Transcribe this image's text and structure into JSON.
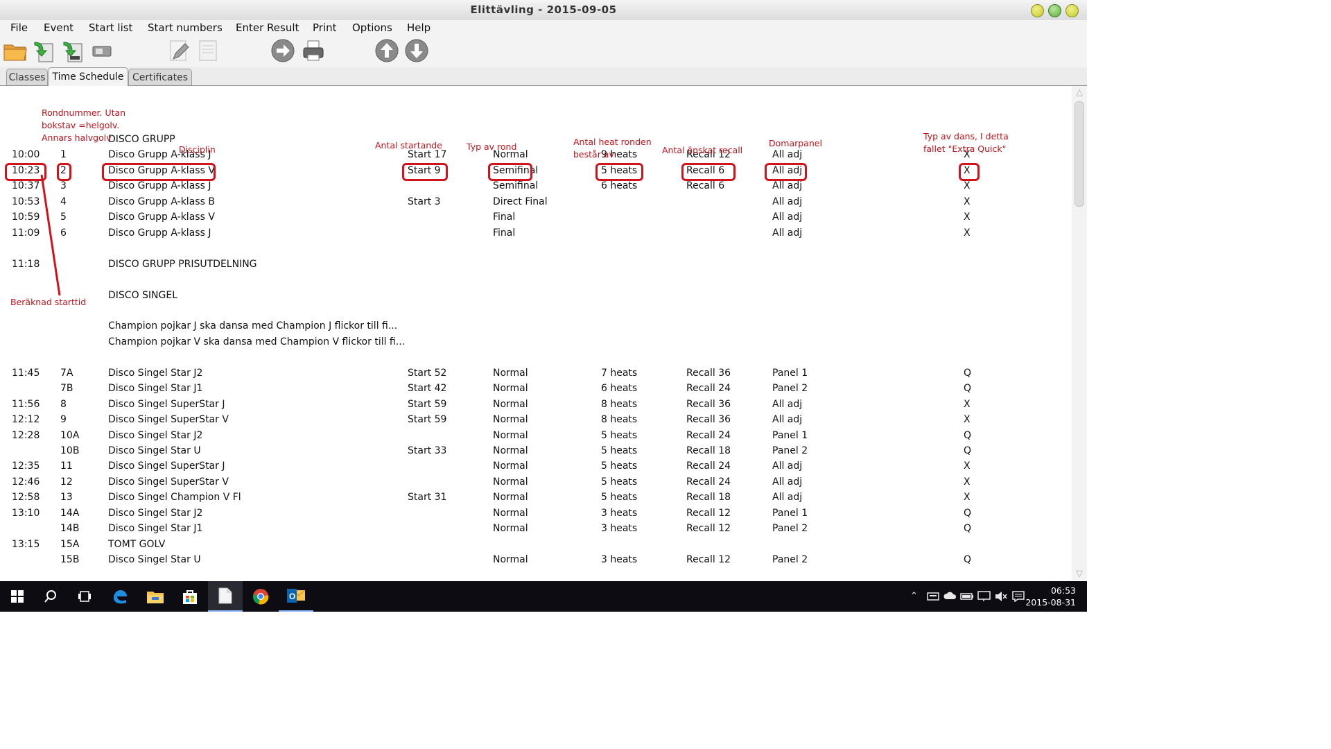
{
  "window": {
    "title": "Elittävling - 2015-09-05"
  },
  "menu": [
    "File",
    "Event",
    "Start list",
    "Start numbers",
    "Enter Result",
    "Print",
    "Options",
    "Help"
  ],
  "toolbar_icons": [
    "open-folder-icon",
    "import-green-arrow-icon",
    "export-green-arrow-icon",
    "usb-device-icon",
    "edit-pencil-icon",
    "document-icon",
    "forward-arrow-icon",
    "printer-icon",
    "move-up-icon",
    "move-down-icon"
  ],
  "tabs": [
    "Classes",
    "Time Schedule",
    "Certificates"
  ],
  "active_tab": "Time Schedule",
  "colors": {
    "annotation": "#c0141c",
    "highlight": "#d0131c",
    "taskbar": "#0c0c12",
    "titlebar_button": "#c9c927"
  },
  "annotations": {
    "rondnummer": [
      "Rondnummer. Utan",
      "bokstav =helgolv.",
      "Annars halvgolv"
    ],
    "disciplin": "Disciplin",
    "antal_startande": "Antal startande",
    "typ_av_rond": "Typ av rond",
    "antal_heat": [
      "Antal heat  ronden",
      "består av"
    ],
    "antal_recall": "Antal önskat recall",
    "domarpanel": "Domarpanel",
    "typ_av_dans": [
      "Typ av dans, I detta",
      "fallet \"Extra Quick\""
    ],
    "beraknad_starttid": "Beräknad starttid"
  },
  "schedule": [
    {
      "time": "",
      "round": "",
      "discipline": "DISCO GRUPP",
      "start": "",
      "type": "",
      "heats": "",
      "recall": "",
      "panel": "",
      "dance": ""
    },
    {
      "time": "10:00",
      "round": "1",
      "discipline": "Disco Grupp A-klass J",
      "start": "Start 17",
      "type": "Normal",
      "heats": "9 heats",
      "recall": "Recall 12",
      "panel": "All adj",
      "dance": "X"
    },
    {
      "time": "10:23",
      "round": "2",
      "discipline": "Disco Grupp A-klass V",
      "start": "Start 9",
      "type": "Semifinal",
      "heats": "5 heats",
      "recall": "Recall 6",
      "panel": "All adj",
      "dance": "X"
    },
    {
      "time": "10:37",
      "round": "3",
      "discipline": "Disco Grupp A-klass J",
      "start": "",
      "type": "Semifinal",
      "heats": "6 heats",
      "recall": "Recall 6",
      "panel": "All adj",
      "dance": "X"
    },
    {
      "time": "10:53",
      "round": "4",
      "discipline": "Disco Grupp A-klass B",
      "start": "Start 3",
      "type": "Direct Final",
      "heats": "",
      "recall": "",
      "panel": "All adj",
      "dance": "X"
    },
    {
      "time": "10:59",
      "round": "5",
      "discipline": "Disco Grupp A-klass V",
      "start": "",
      "type": "Final",
      "heats": "",
      "recall": "",
      "panel": "All adj",
      "dance": "X"
    },
    {
      "time": "11:09",
      "round": "6",
      "discipline": "Disco Grupp A-klass J",
      "start": "",
      "type": "Final",
      "heats": "",
      "recall": "",
      "panel": "All adj",
      "dance": "X"
    },
    {
      "time": "",
      "round": "",
      "discipline": "",
      "start": "",
      "type": "",
      "heats": "",
      "recall": "",
      "panel": "",
      "dance": ""
    },
    {
      "time": "11:18",
      "round": "",
      "discipline": "DISCO GRUPP PRISUTDELNING",
      "start": "",
      "type": "",
      "heats": "",
      "recall": "",
      "panel": "",
      "dance": ""
    },
    {
      "time": "",
      "round": "",
      "discipline": "",
      "start": "",
      "type": "",
      "heats": "",
      "recall": "",
      "panel": "",
      "dance": ""
    },
    {
      "time": "",
      "round": "",
      "discipline": "DISCO SINGEL",
      "start": "",
      "type": "",
      "heats": "",
      "recall": "",
      "panel": "",
      "dance": ""
    },
    {
      "time": "",
      "round": "",
      "discipline": "",
      "start": "",
      "type": "",
      "heats": "",
      "recall": "",
      "panel": "",
      "dance": ""
    },
    {
      "time": "",
      "round": "",
      "discipline": "Champion pojkar J ska dansa med Champion J flickor till fi...",
      "start": "",
      "type": "",
      "heats": "",
      "recall": "",
      "panel": "",
      "dance": ""
    },
    {
      "time": "",
      "round": "",
      "discipline": "Champion pojkar V ska dansa med Champion V flickor till fi...",
      "start": "",
      "type": "",
      "heats": "",
      "recall": "",
      "panel": "",
      "dance": ""
    },
    {
      "time": "",
      "round": "",
      "discipline": "",
      "start": "",
      "type": "",
      "heats": "",
      "recall": "",
      "panel": "",
      "dance": ""
    },
    {
      "time": "11:45",
      "round": "7A",
      "discipline": "Disco Singel Star J2",
      "start": "Start 52",
      "type": "Normal",
      "heats": "7 heats",
      "recall": "Recall 36",
      "panel": "Panel 1",
      "dance": "Q"
    },
    {
      "time": "",
      "round": "7B",
      "discipline": "Disco Singel Star J1",
      "start": "Start 42",
      "type": "Normal",
      "heats": "6 heats",
      "recall": "Recall 24",
      "panel": "Panel 2",
      "dance": "Q"
    },
    {
      "time": "11:56",
      "round": "8",
      "discipline": "Disco Singel SuperStar J",
      "start": "Start 59",
      "type": "Normal",
      "heats": "8 heats",
      "recall": "Recall 36",
      "panel": "All adj",
      "dance": "X"
    },
    {
      "time": "12:12",
      "round": "9",
      "discipline": "Disco Singel SuperStar V",
      "start": "Start 59",
      "type": "Normal",
      "heats": "8 heats",
      "recall": "Recall 36",
      "panel": "All adj",
      "dance": "X"
    },
    {
      "time": "12:28",
      "round": "10A",
      "discipline": "Disco Singel Star J2",
      "start": "",
      "type": "Normal",
      "heats": "5 heats",
      "recall": "Recall 24",
      "panel": "Panel 1",
      "dance": "Q"
    },
    {
      "time": "",
      "round": "10B",
      "discipline": "Disco Singel Star U",
      "start": "Start 33",
      "type": "Normal",
      "heats": "5 heats",
      "recall": "Recall 18",
      "panel": "Panel 2",
      "dance": "Q"
    },
    {
      "time": "12:35",
      "round": "11",
      "discipline": "Disco Singel SuperStar J",
      "start": "",
      "type": "Normal",
      "heats": "5 heats",
      "recall": "Recall 24",
      "panel": "All adj",
      "dance": "X"
    },
    {
      "time": "12:46",
      "round": "12",
      "discipline": "Disco Singel SuperStar V",
      "start": "",
      "type": "Normal",
      "heats": "5 heats",
      "recall": "Recall 24",
      "panel": "All adj",
      "dance": "X"
    },
    {
      "time": "12:58",
      "round": "13",
      "discipline": "Disco Singel Champion V Fl",
      "start": "Start 31",
      "type": "Normal",
      "heats": "5 heats",
      "recall": "Recall 18",
      "panel": "All adj",
      "dance": "X"
    },
    {
      "time": "13:10",
      "round": "14A",
      "discipline": "Disco Singel Star J2",
      "start": "",
      "type": "Normal",
      "heats": "3 heats",
      "recall": "Recall 12",
      "panel": "Panel 1",
      "dance": "Q"
    },
    {
      "time": "",
      "round": "14B",
      "discipline": "Disco Singel Star J1",
      "start": "",
      "type": "Normal",
      "heats": "3 heats",
      "recall": "Recall 12",
      "panel": "Panel 2",
      "dance": "Q"
    },
    {
      "time": "13:15",
      "round": "15A",
      "discipline": "TOMT GOLV",
      "start": "",
      "type": "",
      "heats": "",
      "recall": "",
      "panel": "",
      "dance": ""
    },
    {
      "time": "",
      "round": "15B",
      "discipline": "Disco Singel Star U",
      "start": "",
      "type": "Normal",
      "heats": "3 heats",
      "recall": "Recall 12",
      "panel": "Panel 2",
      "dance": "Q"
    }
  ],
  "taskbar_icons": [
    "windows-start-icon",
    "search-icon",
    "task-view-icon",
    "edge-browser-icon",
    "file-explorer-icon",
    "store-icon",
    "document-app-icon",
    "chrome-icon",
    "outlook-icon"
  ],
  "tray_icons": [
    "chevron-up-icon",
    "network-drive-icon",
    "onedrive-cloud-icon",
    "battery-icon",
    "display-icon",
    "volume-muted-icon",
    "action-center-icon"
  ],
  "clock": {
    "time": "06:53",
    "date": "2015-08-31"
  }
}
